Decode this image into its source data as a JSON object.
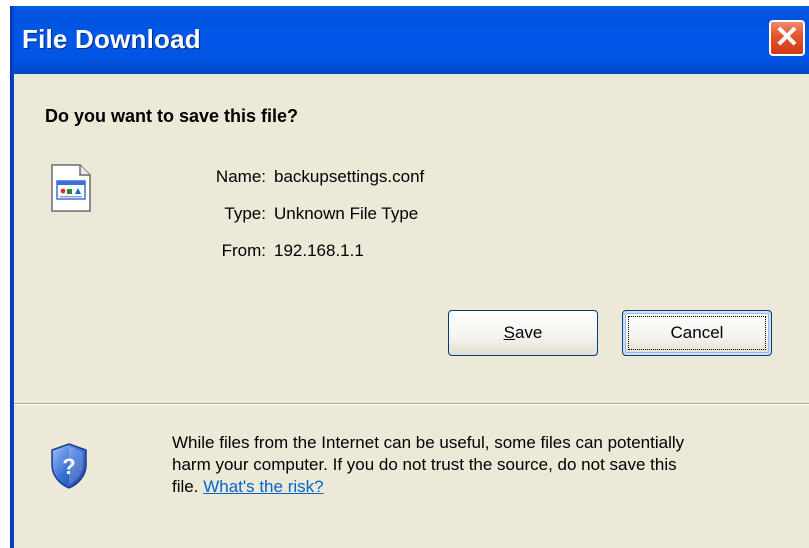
{
  "window": {
    "title": "File Download"
  },
  "dialog": {
    "question": "Do you want to save this file?",
    "file": {
      "name_label": "Name:",
      "name_value": "backupsettings.conf",
      "type_label": "Type:",
      "type_value": "Unknown File Type",
      "from_label": "From:",
      "from_value": "192.168.1.1"
    },
    "buttons": {
      "save_mnemonic": "S",
      "save_rest": "ave",
      "cancel": "Cancel"
    },
    "warning": {
      "line1": "While files from the Internet can be useful, some files can potentially",
      "line2": "harm your computer. If you do not trust the source, do not save this",
      "line3_prefix": "file. ",
      "risk_link": "What's the risk?"
    }
  },
  "icons": {
    "close": "close-icon",
    "file": "file-icon",
    "security": "shield-question-icon"
  },
  "colors": {
    "titlebar": "#0055e5",
    "close_button": "#e2542d",
    "dialog_bg": "#ece9d8",
    "link": "#0066cc"
  }
}
